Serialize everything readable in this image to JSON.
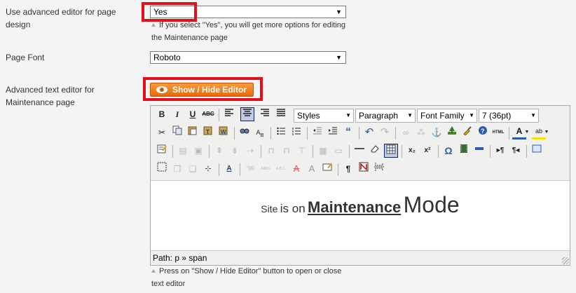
{
  "fields": {
    "advanced_editor": {
      "label": "Use advanced editor for page design",
      "value": "Yes",
      "hint": "If you select \"Yes\", you will get more options for editing the Maintenance page"
    },
    "page_font": {
      "label": "Page Font",
      "value": "Roboto"
    },
    "text_editor": {
      "label": "Advanced text editor for Maintenance page",
      "button_label": "Show / Hide Editor",
      "hint": "Press on \"Show / Hide Editor\" button to open or close text editor"
    }
  },
  "highlight_color": "#e2101b",
  "button_color": "#f07c1c",
  "editor": {
    "toolbar": {
      "styles_label": "Styles",
      "format_label": "Paragraph",
      "font_family_label": "Font Family",
      "font_size_label": "7 (36pt)",
      "bold": "B",
      "italic": "I",
      "underline": "U",
      "strike": "ABC",
      "html": "HTML",
      "sup": "x²",
      "sub": "x₂",
      "omega": "Ω",
      "pilcrow": "¶"
    },
    "content": {
      "w1": "Site",
      "w2": "is on",
      "w3": "Maintenance",
      "w4": "Mode"
    },
    "path": "Path: p » span"
  }
}
